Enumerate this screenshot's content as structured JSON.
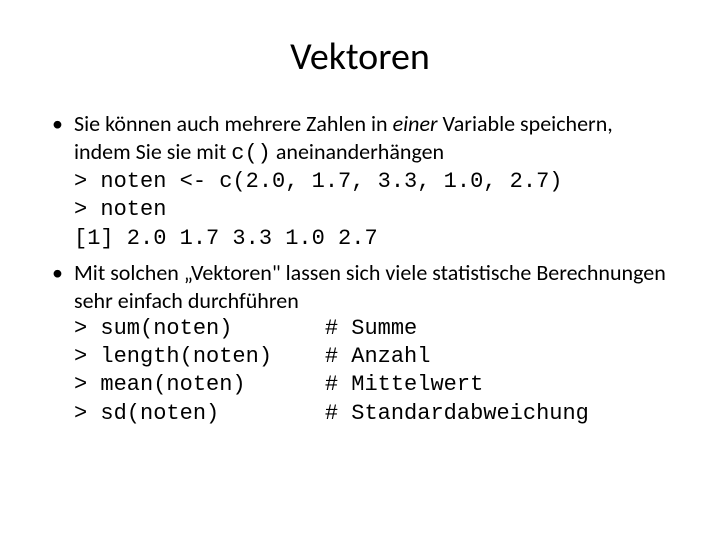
{
  "title": "Vektoren",
  "bullet1": {
    "t1": "Sie können auch mehrere Zahlen in ",
    "em": "einer",
    "t2": " Variable speichern, indem Sie sie mit ",
    "code": "c()",
    "t3": " aneinanderhängen",
    "codelines": "> noten <- c(2.0, 1.7, 3.3, 1.0, 2.7)\n> noten\n[1] 2.0 1.7 3.3 1.0 2.7"
  },
  "bullet2": {
    "text": "Mit solchen „Vektoren\" lassen sich viele statistische Berechnungen sehr einfach durchführen",
    "codelines": "> sum(noten)       # Summe\n> length(noten)    # Anzahl\n> mean(noten)      # Mittelwert\n> sd(noten)        # Standardabweichung"
  }
}
